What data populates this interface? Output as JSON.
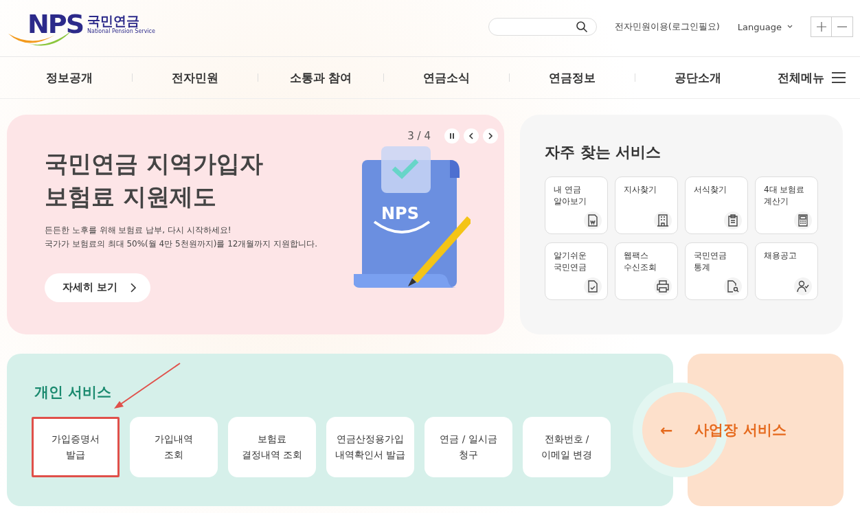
{
  "header": {
    "logo": {
      "mark": "NPS",
      "name": "국민연금",
      "subtitle": "National Pension Service"
    },
    "links": [
      "전자민원이용(로그인필요)",
      "Language"
    ]
  },
  "nav": {
    "items": [
      "정보공개",
      "전자민원",
      "소통과 참여",
      "연금소식",
      "연금정보",
      "공단소개"
    ],
    "all_menu": "전체메뉴"
  },
  "banner": {
    "counter": "3 / 4",
    "title": "국민연금 지역가입자\n보험료 지원제도",
    "description": "든든한 노후를 위해 보험료 납부, 다시 시작하세요!\n국가가 보험료의 최대 50%(월 4만 5천원까지)를 12개월까지 지원합니다.",
    "button": "자세히 보기",
    "illustration_text": "NPS"
  },
  "quick_services": {
    "title": "자주 찾는 서비스",
    "items": [
      {
        "label": "내 연금\n알아보기",
        "kind": "won-doc"
      },
      {
        "label": "지사찾기",
        "kind": "building"
      },
      {
        "label": "서식찾기",
        "kind": "clipboard"
      },
      {
        "label": "4대 보험료\n계산기",
        "kind": "calculator"
      },
      {
        "label": "알기쉬운\n국민연금",
        "kind": "doc-check"
      },
      {
        "label": "웹팩스\n수신조회",
        "kind": "printer"
      },
      {
        "label": "국민연금\n통계",
        "kind": "doc-search"
      },
      {
        "label": "채용공고",
        "kind": "person"
      }
    ]
  },
  "personal_services": {
    "title": "개인 서비스",
    "items": [
      {
        "label": "가입증명서\n발급",
        "highlighted": true
      },
      {
        "label": "가입내역\n조회",
        "highlighted": false
      },
      {
        "label": "보험료\n결정내역 조회",
        "highlighted": false
      },
      {
        "label": "연금산정용가입\n내역확인서 발급",
        "highlighted": false
      },
      {
        "label": "연금 / 일시금\n청구",
        "highlighted": false
      },
      {
        "label": "전화번호 /\n이메일 변경",
        "highlighted": false
      }
    ]
  },
  "business_services": {
    "arrow": "←",
    "label": "사업장 서비스"
  }
}
